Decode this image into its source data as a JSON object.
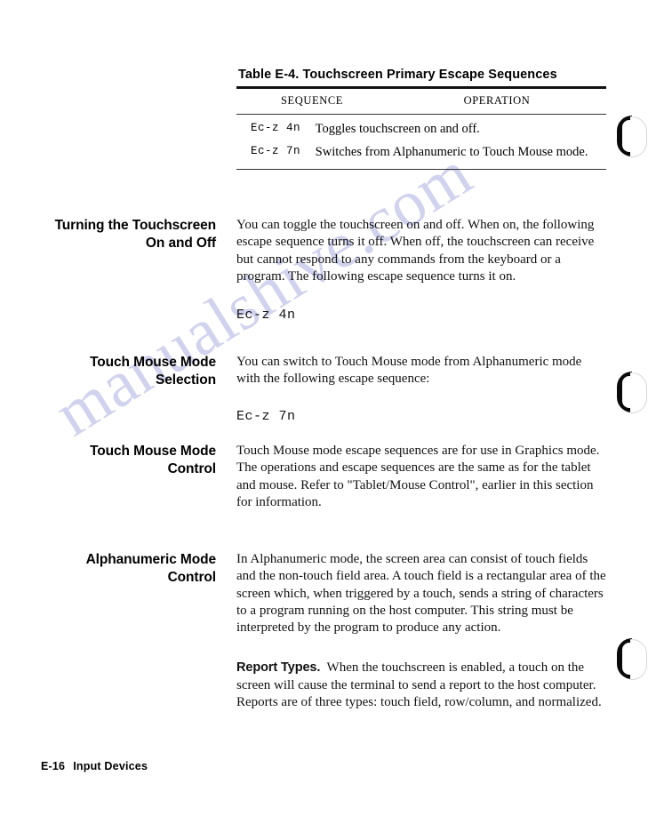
{
  "document": {
    "table": {
      "title": "Table E-4.  Touchscreen Primary Escape Sequences",
      "columns": {
        "sequence": "SEQUENCE",
        "operation": "OPERATION"
      },
      "rows": [
        {
          "sequence": "Ec-z 4n",
          "operation": "Toggles touchscreen on and off."
        },
        {
          "sequence": "Ec-z 7n",
          "operation": "Switches from Alphanumeric to Touch Mouse mode."
        }
      ]
    },
    "sections": [
      {
        "heading": "Turning the Touchscreen On and Off",
        "paragraph": "You can toggle the touchscreen on and off. When on, the following escape sequence turns it off. When off, the touchscreen can receive but cannot respond to any commands from the keyboard or a program. The following escape sequence turns it on.",
        "code": "Ec-z 4n"
      },
      {
        "heading": "Touch Mouse Mode Selection",
        "paragraph": "You can switch to Touch Mouse mode from Alphanumeric mode with the following escape sequence:",
        "code": "Ec-z 7n"
      },
      {
        "heading": "Touch Mouse Mode Control",
        "paragraph": "Touch Mouse mode escape sequences are for use in Graphics mode. The operations and escape sequences are the same as for the tablet and mouse. Refer to \"Tablet/Mouse Control\", earlier in this section for information."
      },
      {
        "heading": "Alphanumeric Mode Control",
        "paragraph": "In Alphanumeric mode, the screen area can consist of touch fields and the non-touch field area. A touch field is a rectangular area of the screen which, when triggered by a touch, sends a string of characters to a program running on the host computer. This string must be interpreted by the program to produce any action.",
        "subsection": {
          "lead": "Report Types.",
          "paragraph": "When the touchscreen is enabled, a touch on the screen will cause the terminal to send a report to the host computer. Reports are of three types: touch field, row/column, and normalized."
        }
      }
    ],
    "footer": {
      "page_number": "E-16",
      "section_title": "Input Devices"
    },
    "watermark": {
      "text": "manualshive.com",
      "color": "#c9ccec"
    }
  }
}
